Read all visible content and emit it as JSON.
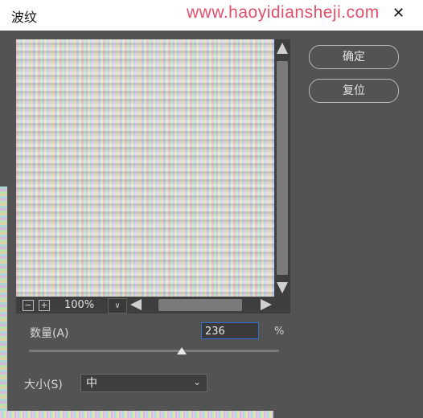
{
  "window": {
    "title": "波纹",
    "watermark": "www.haoyidiansheji.com",
    "close_glyph": "✕"
  },
  "preview": {
    "zoom": "100%",
    "zoom_out_glyph": "−",
    "zoom_in_glyph": "+",
    "dropdown_glyph": "∨"
  },
  "buttons": {
    "ok": "确定",
    "reset": "复位"
  },
  "amount": {
    "label": "数量(A)",
    "value": "236",
    "unit": "%",
    "slider_fraction": 0.61
  },
  "size": {
    "label": "大小(S)",
    "selected": "中",
    "chevron": "⌄"
  },
  "colors": {
    "panel": "#535353",
    "input_focus": "#2f6fd0",
    "watermark": "#e0506a"
  }
}
